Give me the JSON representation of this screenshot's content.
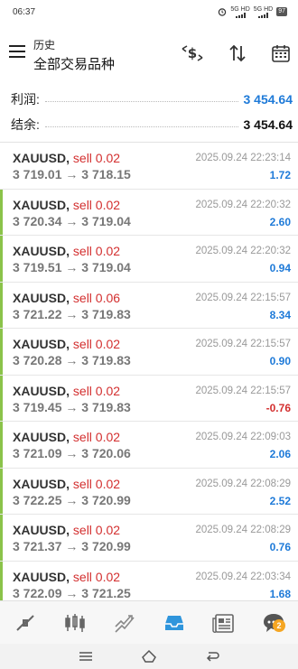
{
  "statusbar": {
    "time": "06:37",
    "net1": "5G HD",
    "net2": "5G HD",
    "battery": "97"
  },
  "appbar": {
    "subtitle": "历史",
    "title": "全部交易品种"
  },
  "summary": [
    {
      "label": "利润:",
      "value": "3 454.64",
      "color": "#1e7ad8"
    },
    {
      "label": "结余:",
      "value": "3 454.64",
      "color": "#111111"
    }
  ],
  "deals": [
    {
      "symbol": "XAUUSD,",
      "side": "sell 0.02",
      "open": "3 719.01",
      "close": "3 718.15",
      "time": "2025.09.24 22:23:14",
      "profit": "1.72",
      "sign": "pos",
      "accent": false
    },
    {
      "symbol": "XAUUSD,",
      "side": "sell 0.02",
      "open": "3 720.34",
      "close": "3 719.04",
      "time": "2025.09.24 22:20:32",
      "profit": "2.60",
      "sign": "pos",
      "accent": true
    },
    {
      "symbol": "XAUUSD,",
      "side": "sell 0.02",
      "open": "3 719.51",
      "close": "3 719.04",
      "time": "2025.09.24 22:20:32",
      "profit": "0.94",
      "sign": "pos",
      "accent": true
    },
    {
      "symbol": "XAUUSD,",
      "side": "sell 0.06",
      "open": "3 721.22",
      "close": "3 719.83",
      "time": "2025.09.24 22:15:57",
      "profit": "8.34",
      "sign": "pos",
      "accent": true
    },
    {
      "symbol": "XAUUSD,",
      "side": "sell 0.02",
      "open": "3 720.28",
      "close": "3 719.83",
      "time": "2025.09.24 22:15:57",
      "profit": "0.90",
      "sign": "pos",
      "accent": true
    },
    {
      "symbol": "XAUUSD,",
      "side": "sell 0.02",
      "open": "3 719.45",
      "close": "3 719.83",
      "time": "2025.09.24 22:15:57",
      "profit": "-0.76",
      "sign": "neg",
      "accent": true
    },
    {
      "symbol": "XAUUSD,",
      "side": "sell 0.02",
      "open": "3 721.09",
      "close": "3 720.06",
      "time": "2025.09.24 22:09:03",
      "profit": "2.06",
      "sign": "pos",
      "accent": true
    },
    {
      "symbol": "XAUUSD,",
      "side": "sell 0.02",
      "open": "3 722.25",
      "close": "3 720.99",
      "time": "2025.09.24 22:08:29",
      "profit": "2.52",
      "sign": "pos",
      "accent": true
    },
    {
      "symbol": "XAUUSD,",
      "side": "sell 0.02",
      "open": "3 721.37",
      "close": "3 720.99",
      "time": "2025.09.24 22:08:29",
      "profit": "0.76",
      "sign": "pos",
      "accent": true
    },
    {
      "symbol": "XAUUSD,",
      "side": "sell 0.02",
      "open": "3 722.09",
      "close": "3 721.25",
      "time": "2025.09.24 22:03:34",
      "profit": "1.68",
      "sign": "pos",
      "accent": true
    }
  ],
  "arrow": "→",
  "bottomnav": [
    {
      "icon": "quotes-icon",
      "active": false
    },
    {
      "icon": "chart-icon",
      "active": false
    },
    {
      "icon": "trade-icon",
      "active": false
    },
    {
      "icon": "history-icon",
      "active": true
    },
    {
      "icon": "news-icon",
      "active": false
    },
    {
      "icon": "messages-icon",
      "active": false,
      "badge": "2"
    }
  ],
  "colors": {
    "accent_green": "#8bc34a",
    "profit_blue": "#1e7ad8",
    "loss_red": "#d32f2f",
    "active_nav": "#2f95dc"
  }
}
